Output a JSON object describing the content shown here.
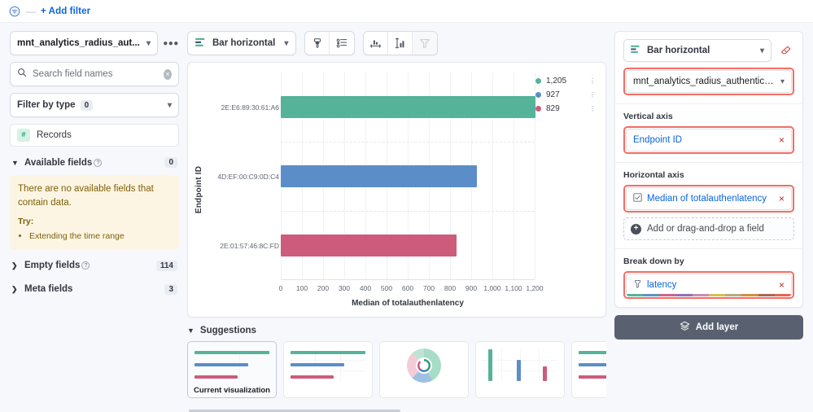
{
  "filterbar": {
    "add_filter_label": "+ Add filter",
    "filter_icon": "filter-icon",
    "dash": "—"
  },
  "left_panel": {
    "datasource": {
      "label": "mnt_analytics_radius_aut...",
      "chevron": "chevron-down-icon",
      "more_icon": "more-options-icon"
    },
    "search": {
      "placeholder": "Search field names",
      "value": "",
      "icon": "search-icon",
      "clear": "×"
    },
    "filter_by_type": {
      "label": "Filter by type",
      "count": "0",
      "chevron": "chevron-down-icon"
    },
    "records": {
      "label": "Records",
      "icon_glyph": "#"
    },
    "available_fields": {
      "label": "Available fields",
      "count": "0",
      "arrow": "chevron-down-icon"
    },
    "empty_state": {
      "message": "There are no available fields that contain data.",
      "try_label": "Try:",
      "suggestions": [
        "Extending the time range"
      ]
    },
    "empty_fields": {
      "label": "Empty fields",
      "count": "114",
      "arrow": "chevron-right-icon"
    },
    "meta_fields": {
      "label": "Meta fields",
      "count": "3",
      "arrow": "chevron-right-icon"
    }
  },
  "toolbar": {
    "vis_type": {
      "label": "Bar horizontal",
      "icon": "bar-horizontal-icon",
      "chevron": "chevron-down-icon"
    },
    "buttons": [
      {
        "name": "appearance-button",
        "icon": "paintbrush-icon",
        "disabled": false
      },
      {
        "name": "legend-button",
        "icon": "legend-list-icon",
        "disabled": false
      },
      {
        "name": "horizontal-axis-button",
        "icon": "horizontal-axis-icon",
        "disabled": false
      },
      {
        "name": "vertical-axis-button",
        "icon": "vertical-axis-icon",
        "disabled": false
      },
      {
        "name": "secondary-axis-button",
        "icon": "filter-axis-icon",
        "disabled": true
      }
    ]
  },
  "chart_data": {
    "type": "bar",
    "orientation": "horizontal",
    "title": "",
    "xlabel": "Median of totalauthenlatency",
    "ylabel": "Endpoint ID",
    "categories": [
      "2E:E6:89:30:61:A6",
      "4D:EF:00:C9:0D:C4",
      "2E:01:57:46:8C:FD"
    ],
    "values": [
      1205,
      927,
      829
    ],
    "value_labels": [
      "1,205",
      "927",
      "829"
    ],
    "colors": [
      "#54b399",
      "#5b8ec9",
      "#cc5b7c"
    ],
    "xlim": [
      0,
      1200
    ],
    "xticks": [
      "0",
      "100",
      "200",
      "300",
      "400",
      "500",
      "600",
      "700",
      "800",
      "900",
      "1,000",
      "1,100",
      "1,200"
    ],
    "xtick_values": [
      0,
      100,
      200,
      300,
      400,
      500,
      600,
      700,
      800,
      900,
      1000,
      1100,
      1200
    ],
    "grid": true,
    "legend_position": "right",
    "legend": [
      {
        "label": "1,205",
        "color": "#54b399",
        "menu": "legend-item-menu"
      },
      {
        "label": "927",
        "color": "#5b8ec9",
        "menu": "legend-item-menu"
      },
      {
        "label": "829",
        "color": "#cc5b7c",
        "menu": "legend-item-menu"
      }
    ]
  },
  "suggestions": {
    "header": "Suggestions",
    "arrow": "chevron-down-icon",
    "items": [
      {
        "caption": "Current visualization",
        "type": "bar-horizontal",
        "active": true
      },
      {
        "caption": "",
        "type": "bar-horizontal-grid",
        "active": false
      },
      {
        "caption": "",
        "type": "donut",
        "active": false
      },
      {
        "caption": "",
        "type": "bar-vertical",
        "active": false
      },
      {
        "caption": "",
        "type": "bar-horizontal-grid",
        "active": false
      }
    ]
  },
  "right_panel": {
    "vis_type": {
      "label": "Bar horizontal",
      "icon": "bar-horizontal-icon",
      "chevron": "chevron-down-icon"
    },
    "erase_icon": "eraser-icon",
    "datasource": {
      "label": "mnt_analytics_radius_authenticati...",
      "chevron": "chevron-down-icon"
    },
    "vertical_axis": {
      "label": "Vertical axis",
      "dimension": {
        "label": "Endpoint ID",
        "remove": "×"
      }
    },
    "horizontal_axis": {
      "label": "Horizontal axis",
      "dimension": {
        "label": "Median of totalauthenlatency",
        "icon": "function-icon",
        "remove": "×"
      },
      "dropzone": "Add or drag-and-drop a field",
      "dropzone_icon": "plus-circle-icon"
    },
    "break_down_by": {
      "label": "Break down by",
      "dimension": {
        "label": "latency",
        "icon": "field-icon",
        "remove": "×"
      },
      "palette": [
        "#54b399",
        "#6092c0",
        "#d36086",
        "#9170b8",
        "#ca8eae",
        "#d6bf57",
        "#b9a888",
        "#da8b45",
        "#aa6556",
        "#e7664c"
      ]
    },
    "add_layer": {
      "label": "Add layer",
      "icon": "layers-icon"
    }
  },
  "colors": {
    "accent": "#0b64dd",
    "highlight": "#f36d62",
    "danger": "#bd271e",
    "dark_button": "#596170"
  }
}
